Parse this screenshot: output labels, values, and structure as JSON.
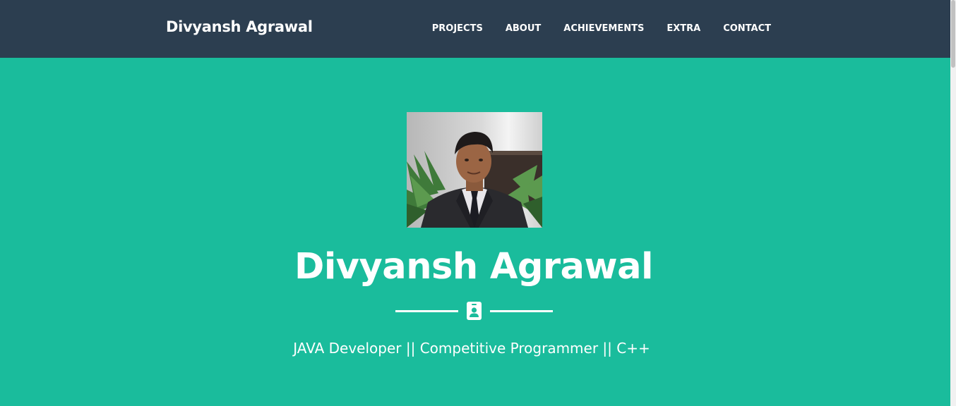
{
  "navbar": {
    "brand": "Divyansh Agrawal",
    "items": [
      {
        "label": "PROJECTS"
      },
      {
        "label": "ABOUT"
      },
      {
        "label": "ACHIEVEMENTS"
      },
      {
        "label": "EXTRA"
      },
      {
        "label": "CONTACT"
      }
    ]
  },
  "masthead": {
    "name": "Divyansh Agrawal",
    "subtitle": "JAVA Developer || Competitive Programmer || C++",
    "divider_icon": "id-badge-icon"
  },
  "colors": {
    "navbar_bg": "#2c3e50",
    "masthead_bg": "#1abc9c",
    "text": "#ffffff"
  }
}
